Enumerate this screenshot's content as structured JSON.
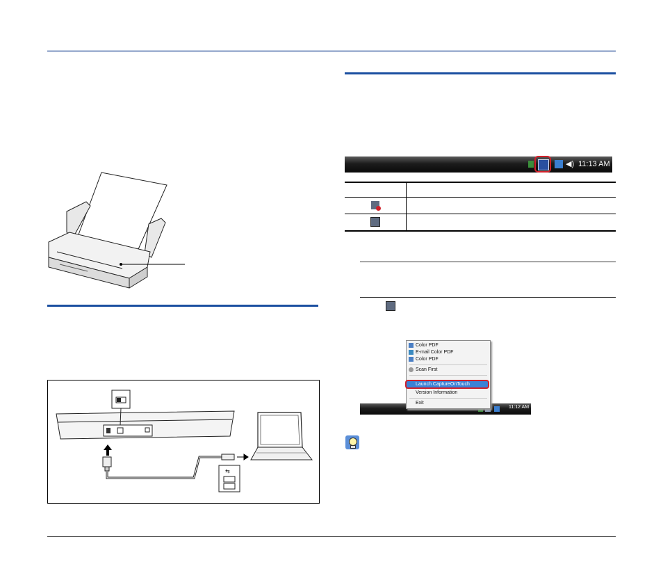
{
  "header_bar": "",
  "left_column": {
    "scanner_illustration": "scanner-with-paper",
    "connection_figure": "usb-connection-diagram"
  },
  "right_column": {
    "taskbar_clock": "11:13 AM",
    "status_table": {
      "headers": [
        "",
        ""
      ],
      "rows": [
        {
          "icon": "capture-on-touch-disabled-icon",
          "text": ""
        },
        {
          "icon": "capture-on-touch-enabled-icon",
          "text": ""
        }
      ]
    },
    "context_menu": {
      "items": [
        "Color PDF",
        "E-mail Color PDF",
        "Color PDF",
        "Scan First",
        "Launch CaptureOnTouch",
        "Version Information",
        "Exit"
      ],
      "highlighted": "Launch CaptureOnTouch",
      "clock": "11:12 AM"
    },
    "hint_icon": "lightbulb-hint-icon"
  },
  "colors": {
    "section_rule": "#1b4fa0",
    "highlight_ring": "#d0202a",
    "menu_highlight": "#3b82d6"
  }
}
